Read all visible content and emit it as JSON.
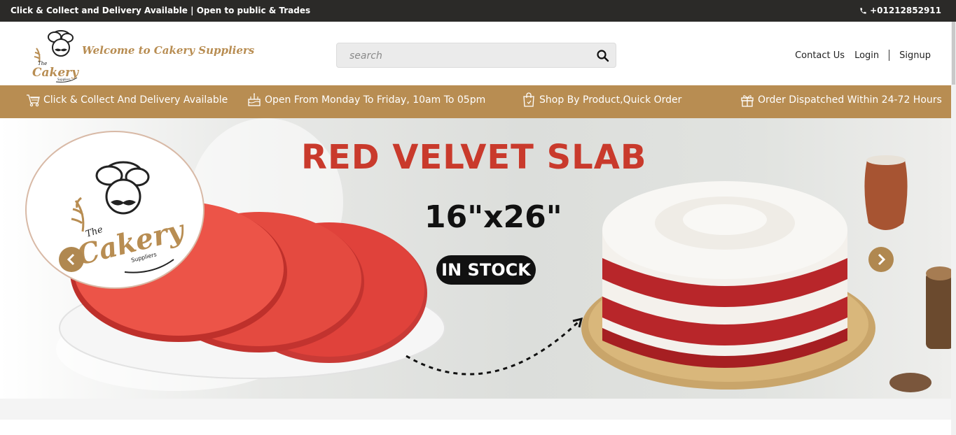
{
  "topbar": {
    "announcement": "Click & Collect and Delivery Available | Open to public & Trades",
    "phone": "+01212852911"
  },
  "header": {
    "welcome": "Welcome to Cakery Suppliers",
    "logo_text_the": "The",
    "logo_text_cakery": "Cakery",
    "logo_text_suppliers": "Suppliers",
    "search_placeholder": "search",
    "nav": {
      "contact": "Contact Us",
      "login": "Login",
      "signup": "Signup"
    }
  },
  "infobar": {
    "items": [
      {
        "label": "Click & Collect And Delivery Available",
        "icon": "cart-icon"
      },
      {
        "label": "Open From Monday To Friday, 10am To 05pm",
        "icon": "cake-icon"
      },
      {
        "label": "Shop By Product,Quick Order",
        "icon": "bag-icon"
      },
      {
        "label": "Order Dispatched Within 24-72 Hours",
        "icon": "gift-icon"
      }
    ]
  },
  "hero": {
    "title": "RED VELVET SLAB",
    "size": "16\"x26\"",
    "stock": "IN STOCK",
    "logo_the": "The",
    "logo_cakery": "Cakery",
    "logo_suppliers": "Suppliers"
  },
  "colors": {
    "topbar_bg": "#2b2a28",
    "accent": "#b88d52",
    "title_red": "#c93a2c"
  }
}
